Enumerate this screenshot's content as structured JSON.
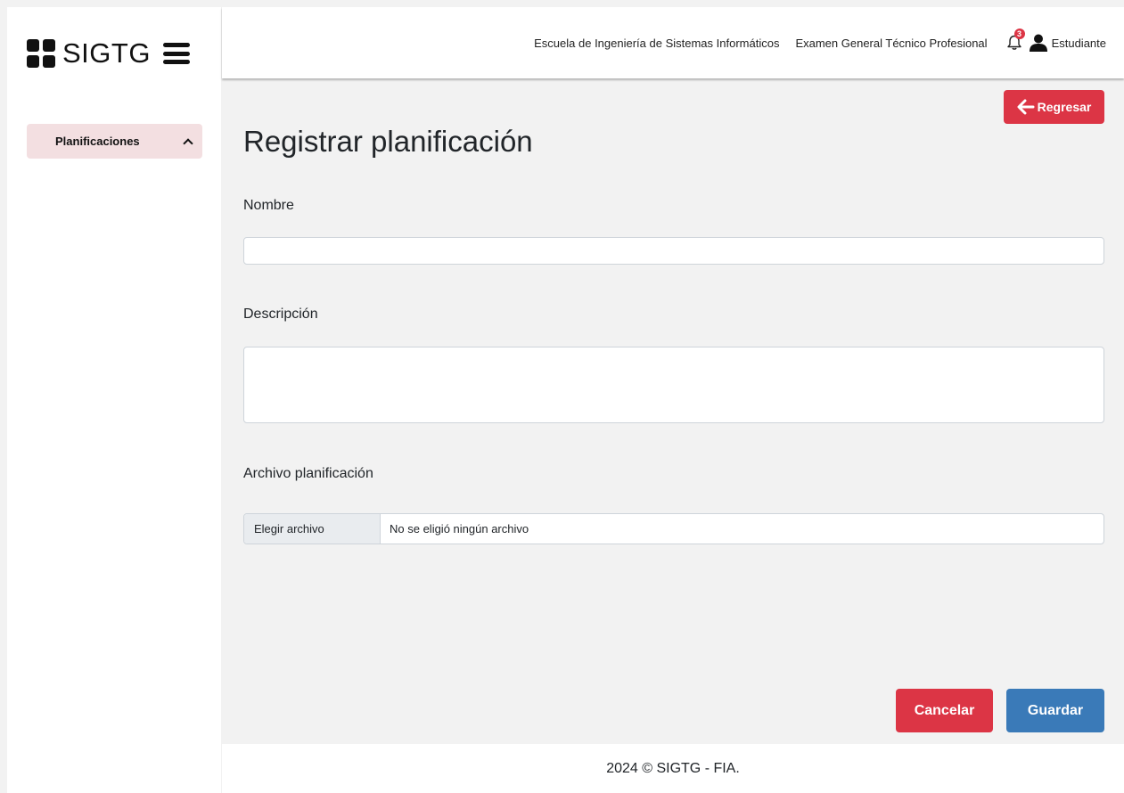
{
  "brand": {
    "name": "SIGTG"
  },
  "sidebar": {
    "items": [
      {
        "label": "Planificaciones"
      }
    ]
  },
  "topbar": {
    "links": [
      {
        "label": "Escuela de Ingeniería de Sistemas Informáticos"
      },
      {
        "label": "Examen General Técnico Profesional"
      }
    ],
    "notifications_count": "3",
    "user_label": "Estudiante"
  },
  "main": {
    "back_label": "Regresar",
    "title": "Registrar planificación",
    "fields": {
      "name_label": "Nombre",
      "name_value": "",
      "description_label": "Descripción",
      "description_value": "",
      "file_label": "Archivo planificación",
      "file_button": "Elegir archivo",
      "file_status": "No se eligió ningún archivo"
    },
    "cancel_label": "Cancelar",
    "save_label": "Guardar"
  },
  "footer": {
    "text": "2024 © SIGTG - FIA."
  },
  "colors": {
    "danger": "#dc3545",
    "primary": "#3a7ab8",
    "sidebar_active": "#f3dfe1",
    "background": "#f2f2f2"
  }
}
